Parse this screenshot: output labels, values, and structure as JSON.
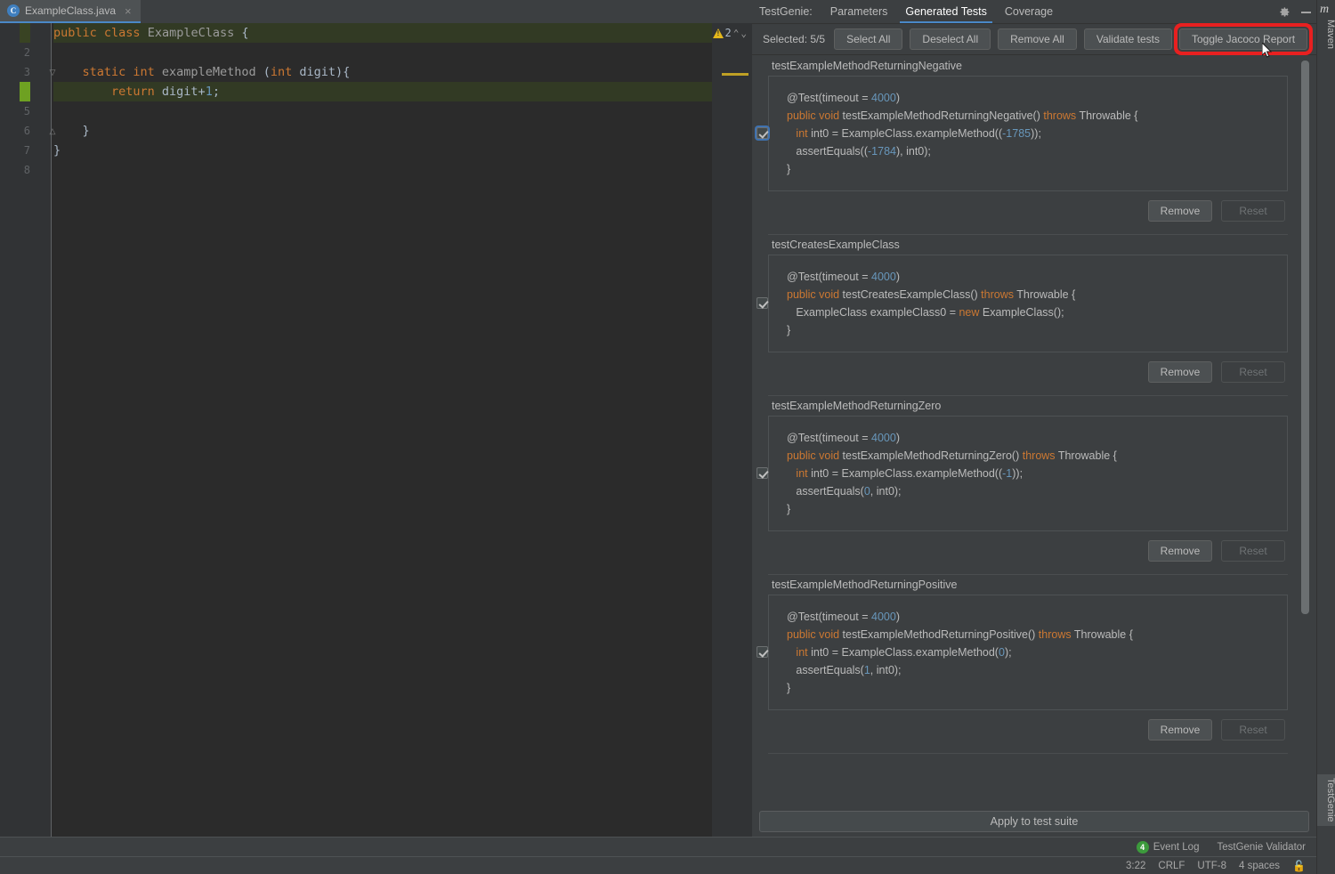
{
  "editor": {
    "tab": {
      "label": "ExampleClass.java",
      "icon": "java-class-icon",
      "close": "×"
    },
    "warnings": {
      "count": "2",
      "icon": "warning-triangle-icon",
      "up": "⌃",
      "down": "⌄"
    },
    "line_numbers": [
      "1",
      "2",
      "3",
      "4",
      "5",
      "6",
      "7",
      "8"
    ],
    "lines": [
      {
        "n": 1,
        "tokens": [
          {
            "t": "public ",
            "c": "kw"
          },
          {
            "t": "class ",
            "c": "kw"
          },
          {
            "t": "ExampleClass ",
            "c": "mth"
          },
          {
            "t": "{",
            "c": "plain"
          }
        ]
      },
      {
        "n": 2,
        "tokens": []
      },
      {
        "n": 3,
        "tokens": [
          {
            "t": "    static ",
            "c": "kw"
          },
          {
            "t": "int ",
            "c": "kw"
          },
          {
            "t": "exampleMethod ",
            "c": "mth"
          },
          {
            "t": "(",
            "c": "plain"
          },
          {
            "t": "int ",
            "c": "kw"
          },
          {
            "t": "digit",
            "c": "plain"
          },
          {
            "t": "){",
            "c": "plain"
          }
        ]
      },
      {
        "n": 4,
        "tokens": [
          {
            "t": "        return ",
            "c": "kw"
          },
          {
            "t": "digit+",
            "c": "plain"
          },
          {
            "t": "1",
            "c": "num"
          },
          {
            "t": ";",
            "c": "plain"
          }
        ]
      },
      {
        "n": 5,
        "tokens": []
      },
      {
        "n": 6,
        "tokens": [
          {
            "t": "    }",
            "c": "plain"
          }
        ]
      },
      {
        "n": 7,
        "tokens": [
          {
            "t": "}",
            "c": "plain"
          }
        ]
      },
      {
        "n": 8,
        "tokens": []
      }
    ]
  },
  "panel": {
    "title": "TestGenie:",
    "tabs": [
      {
        "label": "Parameters",
        "active": false
      },
      {
        "label": "Generated Tests",
        "active": true
      },
      {
        "label": "Coverage",
        "active": false
      }
    ],
    "gear_icon": "gear-icon",
    "minimize_icon": "minimize-icon",
    "toolbar": {
      "selected_label": "Selected: 5/5",
      "select_all": "Select All",
      "deselect_all": "Deselect All",
      "remove_all": "Remove All",
      "validate_tests": "Validate tests",
      "toggle_jacoco": "Toggle Jacoco Report",
      "highlight_color": "#e82020"
    },
    "apply_label": "Apply to test suite",
    "remove_label": "Remove",
    "reset_label": "Reset",
    "tests": [
      {
        "name": "testExampleMethodReturningNegative",
        "checked": true,
        "focused": true,
        "code": [
          [
            {
              "t": "@Test(timeout = ",
              "c": "tplain"
            },
            {
              "t": "4000",
              "c": "tnum"
            },
            {
              "t": ")",
              "c": "tplain"
            }
          ],
          [
            {
              "t": "public void ",
              "c": "tkw"
            },
            {
              "t": "testExampleMethodReturningNegative() ",
              "c": "tplain"
            },
            {
              "t": "throws ",
              "c": "tkw"
            },
            {
              "t": "Throwable {",
              "c": "tplain"
            }
          ],
          [
            {
              "t": "   ",
              "c": "tplain"
            },
            {
              "t": "int ",
              "c": "tkw"
            },
            {
              "t": "int0 = ExampleClass.exampleMethod((",
              "c": "tplain"
            },
            {
              "t": "-1785",
              "c": "tnum"
            },
            {
              "t": "));",
              "c": "tplain"
            }
          ],
          [
            {
              "t": "   assertEquals((",
              "c": "tplain"
            },
            {
              "t": "-1784",
              "c": "tnum"
            },
            {
              "t": "), int0);",
              "c": "tplain"
            }
          ],
          [
            {
              "t": "}",
              "c": "tplain"
            }
          ]
        ]
      },
      {
        "name": "testCreatesExampleClass",
        "checked": true,
        "focused": false,
        "code": [
          [
            {
              "t": "@Test(timeout = ",
              "c": "tplain"
            },
            {
              "t": "4000",
              "c": "tnum"
            },
            {
              "t": ")",
              "c": "tplain"
            }
          ],
          [
            {
              "t": "public void ",
              "c": "tkw"
            },
            {
              "t": "testCreatesExampleClass() ",
              "c": "tplain"
            },
            {
              "t": "throws ",
              "c": "tkw"
            },
            {
              "t": "Throwable {",
              "c": "tplain"
            }
          ],
          [
            {
              "t": "   ExampleClass exampleClass0 = ",
              "c": "tplain"
            },
            {
              "t": "new ",
              "c": "tkw"
            },
            {
              "t": "ExampleClass();",
              "c": "tplain"
            }
          ],
          [
            {
              "t": "}",
              "c": "tplain"
            }
          ]
        ]
      },
      {
        "name": "testExampleMethodReturningZero",
        "checked": true,
        "focused": false,
        "code": [
          [
            {
              "t": "@Test(timeout = ",
              "c": "tplain"
            },
            {
              "t": "4000",
              "c": "tnum"
            },
            {
              "t": ")",
              "c": "tplain"
            }
          ],
          [
            {
              "t": "public void ",
              "c": "tkw"
            },
            {
              "t": "testExampleMethodReturningZero() ",
              "c": "tplain"
            },
            {
              "t": "throws ",
              "c": "tkw"
            },
            {
              "t": "Throwable {",
              "c": "tplain"
            }
          ],
          [
            {
              "t": "   ",
              "c": "tplain"
            },
            {
              "t": "int ",
              "c": "tkw"
            },
            {
              "t": "int0 = ExampleClass.exampleMethod((",
              "c": "tplain"
            },
            {
              "t": "-1",
              "c": "tnum"
            },
            {
              "t": "));",
              "c": "tplain"
            }
          ],
          [
            {
              "t": "   assertEquals(",
              "c": "tplain"
            },
            {
              "t": "0",
              "c": "tnum"
            },
            {
              "t": ", int0);",
              "c": "tplain"
            }
          ],
          [
            {
              "t": "}",
              "c": "tplain"
            }
          ]
        ]
      },
      {
        "name": "testExampleMethodReturningPositive",
        "checked": true,
        "focused": false,
        "code": [
          [
            {
              "t": "@Test(timeout = ",
              "c": "tplain"
            },
            {
              "t": "4000",
              "c": "tnum"
            },
            {
              "t": ")",
              "c": "tplain"
            }
          ],
          [
            {
              "t": "public void ",
              "c": "tkw"
            },
            {
              "t": "testExampleMethodReturningPositive() ",
              "c": "tplain"
            },
            {
              "t": "throws ",
              "c": "tkw"
            },
            {
              "t": "Throwable {",
              "c": "tplain"
            }
          ],
          [
            {
              "t": "   ",
              "c": "tplain"
            },
            {
              "t": "int ",
              "c": "tkw"
            },
            {
              "t": "int0 = ExampleClass.exampleMethod(",
              "c": "tplain"
            },
            {
              "t": "0",
              "c": "tnum"
            },
            {
              "t": ");",
              "c": "tplain"
            }
          ],
          [
            {
              "t": "   assertEquals(",
              "c": "tplain"
            },
            {
              "t": "1",
              "c": "tnum"
            },
            {
              "t": ", int0);",
              "c": "tplain"
            }
          ],
          [
            {
              "t": "}",
              "c": "tplain"
            }
          ]
        ]
      }
    ]
  },
  "right_strip": {
    "maven_label": "Maven",
    "maven_icon": "maven-m-icon",
    "testgenie_label": "TestGenie"
  },
  "status": {
    "event_log": {
      "count": "4",
      "label": "Event Log"
    },
    "validator": "TestGenie Validator",
    "caret": "3:22",
    "line_sep": "CRLF",
    "encoding": "UTF-8",
    "indent": "4 spaces",
    "lock_icon": "unlocked-icon"
  }
}
